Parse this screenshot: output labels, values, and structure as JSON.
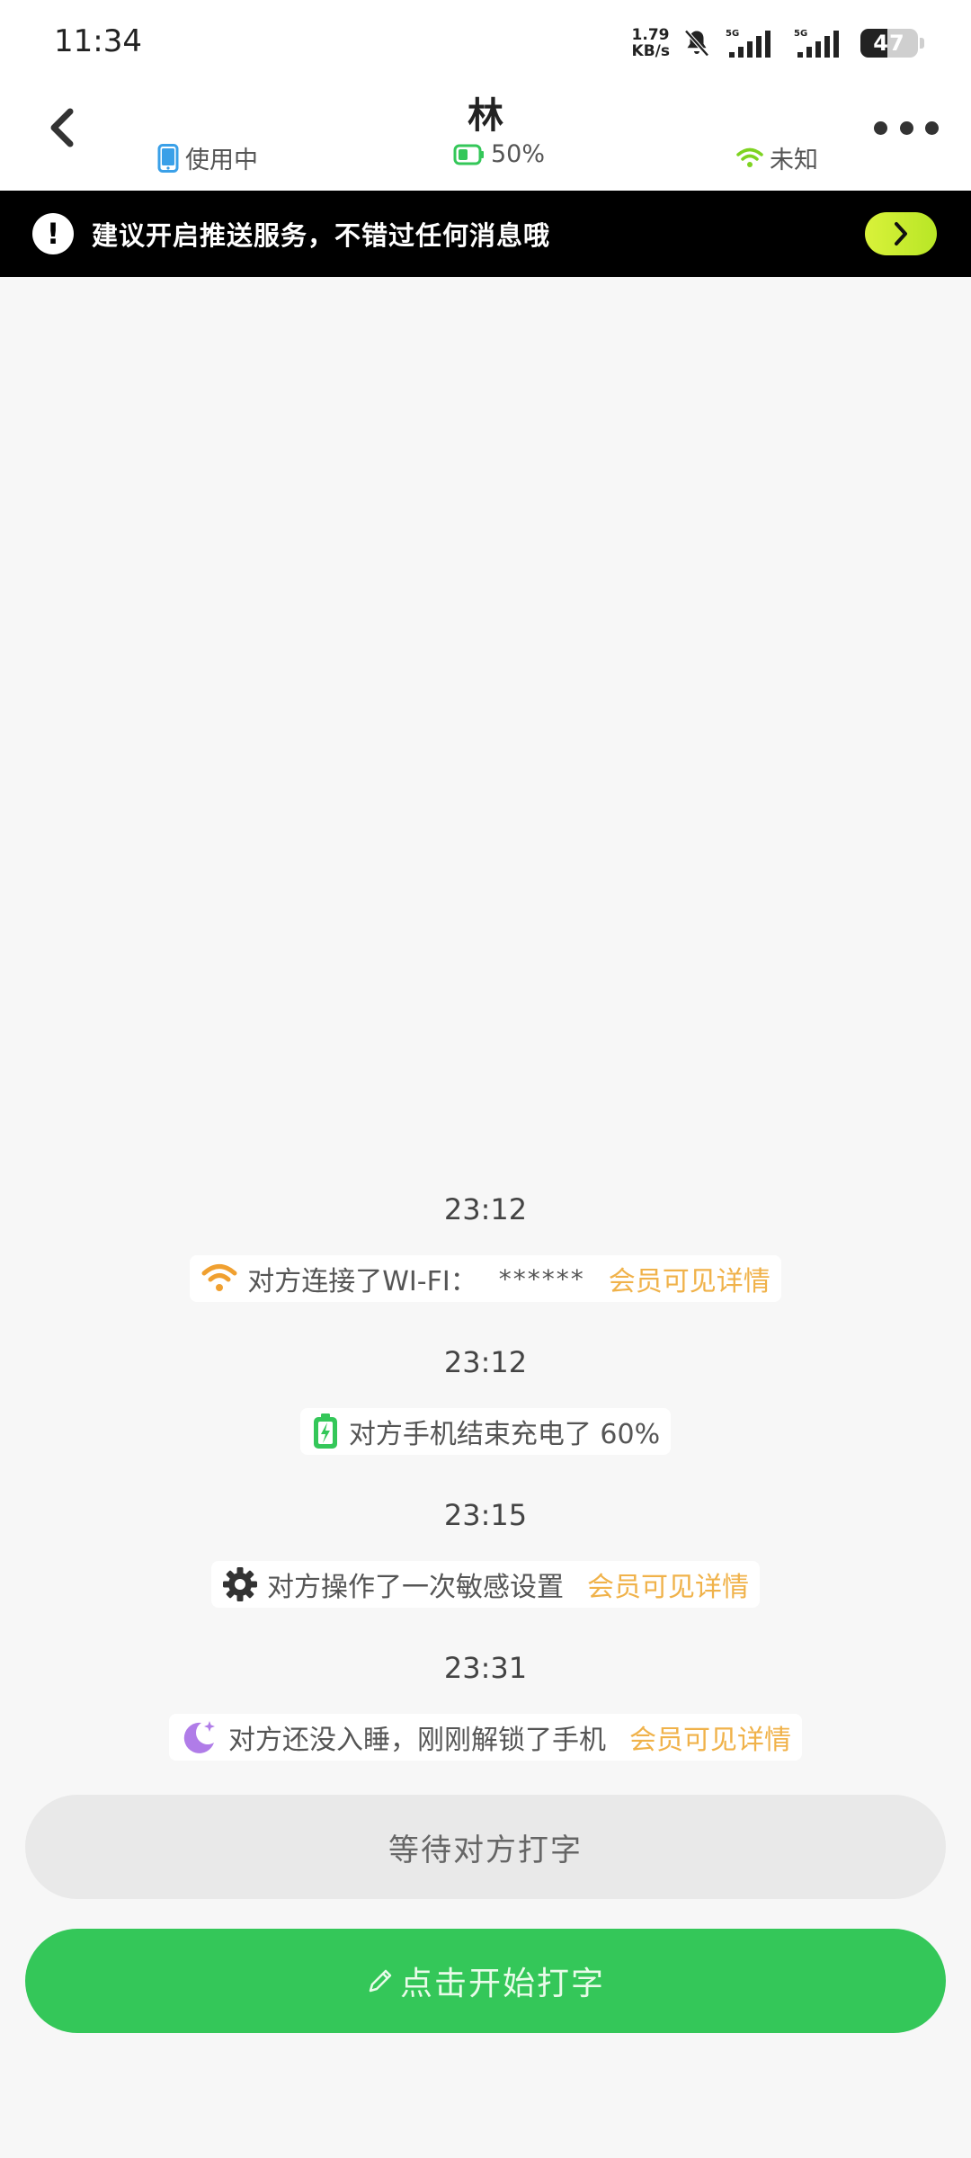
{
  "status_bar": {
    "time": "11:34",
    "net_speed_value": "1.79",
    "net_speed_unit": "KB/s",
    "sim1_label": "5G",
    "sim2_label": "5G",
    "battery_level": "47"
  },
  "header": {
    "title": "林",
    "device_status": "使用中",
    "battery_status": "50%",
    "wifi_status": "未知"
  },
  "banner": {
    "text": "建议开启推送服务，不错过任何消息哦"
  },
  "feed": {
    "events": [
      {
        "time": "23:12",
        "icon": "wifi-icon",
        "text": "对方连接了WI-FI：",
        "masked": "******",
        "vip": "会员可见详情"
      },
      {
        "time": "23:12",
        "icon": "battery-charging-icon",
        "text": "对方手机结束充电了 60%",
        "masked": "",
        "vip": ""
      },
      {
        "time": "23:15",
        "icon": "gear-icon",
        "text": "对方操作了一次敏感设置",
        "masked": "",
        "vip": "会员可见详情"
      },
      {
        "time": "23:31",
        "icon": "moon-icon",
        "text": "对方还没入睡，刚刚解锁了手机",
        "masked": "",
        "vip": "会员可见详情"
      }
    ]
  },
  "buttons": {
    "wait_label": "等待对方打字",
    "type_label": "点击开始打字"
  },
  "colors": {
    "accent_green": "#34c759",
    "vip_orange": "#f0b24a",
    "banner_bg": "#000000",
    "banner_button": "#c8ec2e"
  }
}
